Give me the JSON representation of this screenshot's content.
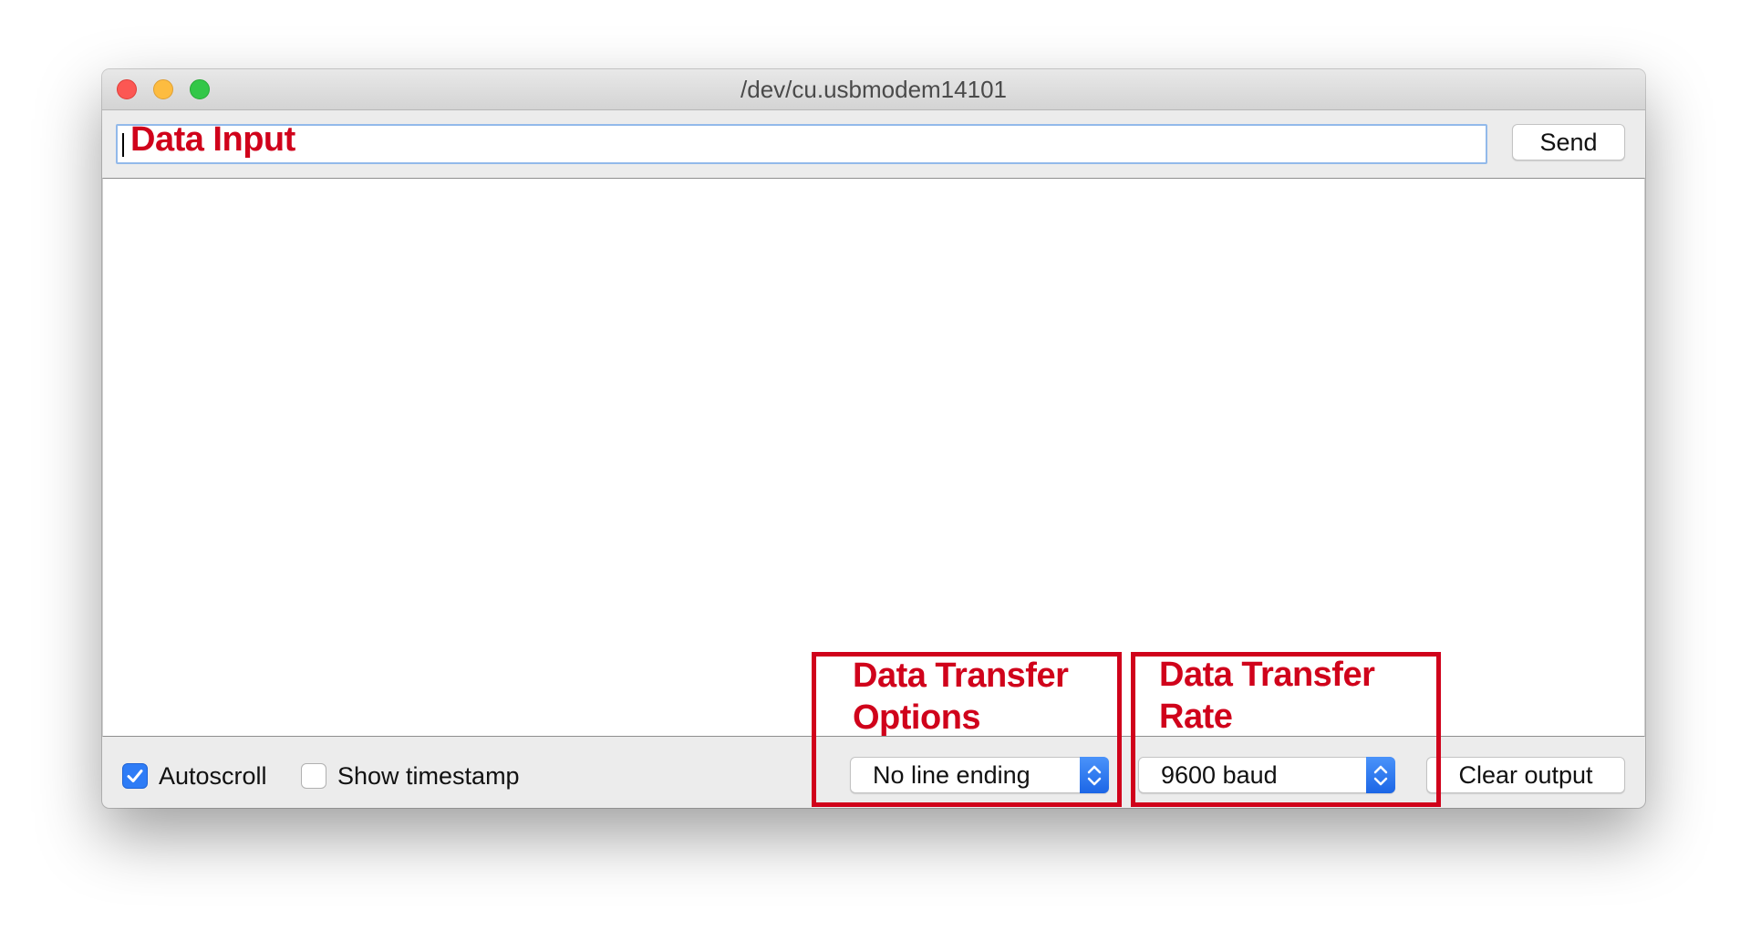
{
  "window": {
    "title": "/dev/cu.usbmodem14101"
  },
  "input": {
    "value": "",
    "annotation": "Data Input"
  },
  "toolbar": {
    "send_label": "Send"
  },
  "footer": {
    "autoscroll_label": "Autoscroll",
    "autoscroll_checked": true,
    "timestamp_label": "Show timestamp",
    "timestamp_checked": false,
    "line_ending_value": "No line ending",
    "baud_value": "9600 baud",
    "clear_label": "Clear output"
  },
  "annotations": {
    "options": "Data Transfer\n Options",
    "rate": "Data Transfer\nRate"
  },
  "colors": {
    "annotation": "#d0021b",
    "accent": "#2e7cf6"
  },
  "icons": {
    "close": "close-light-icon",
    "minimize": "minimize-light-icon",
    "zoom": "zoom-light-icon",
    "check": "checkmark-icon",
    "stepper": "up-down-chevron-icon"
  }
}
